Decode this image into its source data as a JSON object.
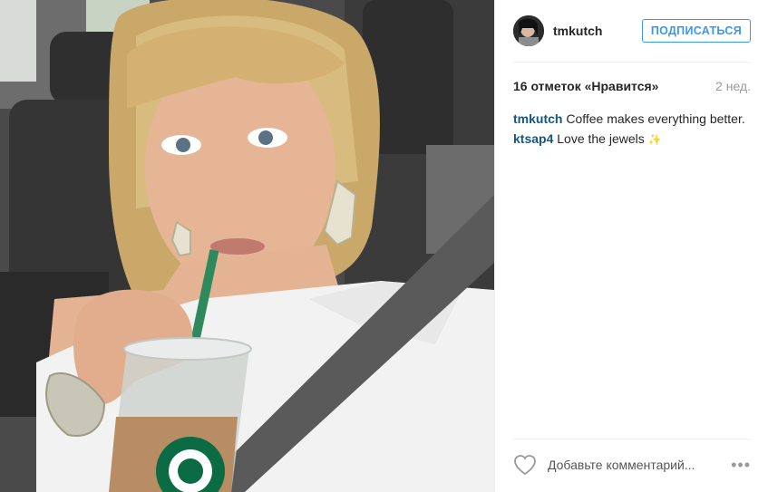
{
  "header": {
    "username": "tmkutch",
    "follow_label": "ПОДПИСАТЬСЯ"
  },
  "meta": {
    "likes": "16 отметок «Нравится»",
    "time": "2 нед."
  },
  "comments": [
    {
      "user": "tmkutch",
      "text": "Coffee makes everything better."
    },
    {
      "user": "ktsap4",
      "text": "Love the jewels",
      "emoji": "✨"
    }
  ],
  "footer": {
    "comment_placeholder": "Добавьте комментарий...",
    "more_icon": "ellipsis-icon",
    "like_icon": "heart-icon"
  },
  "colors": {
    "accent": "#3897f0",
    "comment_user": "#125688",
    "muted": "#999999"
  }
}
